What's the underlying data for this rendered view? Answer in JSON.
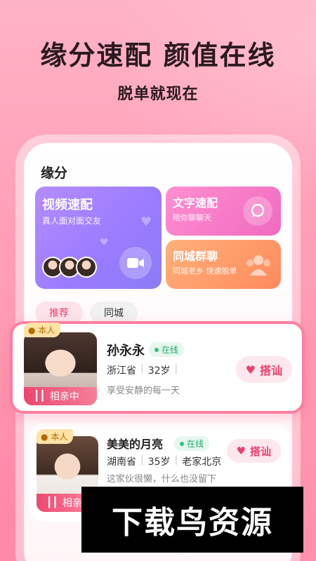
{
  "hero": {
    "headline": "缘分速配 颜值在线",
    "subheadline": "脱单就现在"
  },
  "app": {
    "section_title": "缘分",
    "cards": {
      "video": {
        "title": "视频速配",
        "subtitle": "真人面对面交友"
      },
      "text": {
        "title": "文字速配",
        "subtitle": "陪你聊聊天"
      },
      "city": {
        "title": "同城群聊",
        "subtitle": "同城老乡 快速脱单"
      }
    },
    "tabs": [
      {
        "label": "推荐",
        "active": true
      },
      {
        "label": "同城",
        "active": false
      }
    ],
    "users": [
      {
        "badge": "本人",
        "status_overlay": "相亲中",
        "name": "孙永永",
        "online": "在线",
        "province": "浙江省",
        "age": "32岁",
        "bio": "享受安静的每一天",
        "action": "搭讪"
      },
      {
        "badge": "本人",
        "status_overlay": "相亲中",
        "name": "美美的月亮",
        "online": "在线",
        "province": "湖南省",
        "age": "35岁",
        "hometown": "老家北京",
        "bio": "这家伙很懒，什么也没留下",
        "action": "搭讪"
      }
    ]
  },
  "watermark": "下载鸟资源",
  "colors": {
    "accent": "#ee3f6c",
    "online": "#2ec27e",
    "video_card": "#9a7bff",
    "text_card": "#f06ac0",
    "city_card": "#ff8a5c"
  }
}
